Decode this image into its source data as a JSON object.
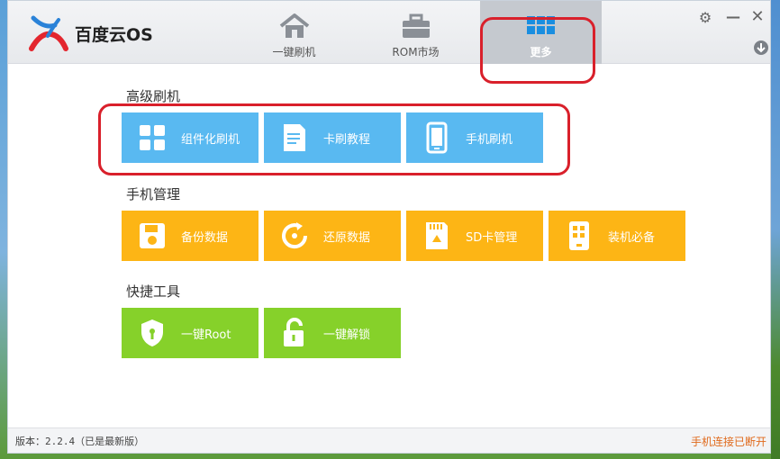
{
  "app": {
    "logo_text": "百度云OS"
  },
  "nav": {
    "home_label": "一键刷机",
    "rom_label": "ROM市场",
    "more_label": "更多"
  },
  "sections": {
    "advanced": {
      "title": "高级刷机",
      "tiles": [
        {
          "label": "组件化刷机",
          "icon": "grid-icon"
        },
        {
          "label": "卡刷教程",
          "icon": "document-icon"
        },
        {
          "label": "手机刷机",
          "icon": "phone-icon"
        }
      ]
    },
    "phone": {
      "title": "手机管理",
      "tiles": [
        {
          "label": "备份数据",
          "icon": "floppy-icon"
        },
        {
          "label": "还原数据",
          "icon": "restore-icon"
        },
        {
          "label": "SD卡管理",
          "icon": "sd-card-icon"
        },
        {
          "label": "装机必备",
          "icon": "apps-phone-icon"
        }
      ]
    },
    "tools": {
      "title": "快捷工具",
      "tiles": [
        {
          "label": "一键Root",
          "icon": "shield-icon"
        },
        {
          "label": "一键解锁",
          "icon": "unlock-icon"
        }
      ]
    }
  },
  "footer": {
    "version": "版本：2.2.4（已是最新版）",
    "status": "手机连接已断开"
  },
  "colors": {
    "blue_tile": "#59b9f1",
    "orange_tile": "#fdb515",
    "green_tile": "#86d12a",
    "highlight": "#d9202b",
    "status_text": "#e06a1c"
  }
}
